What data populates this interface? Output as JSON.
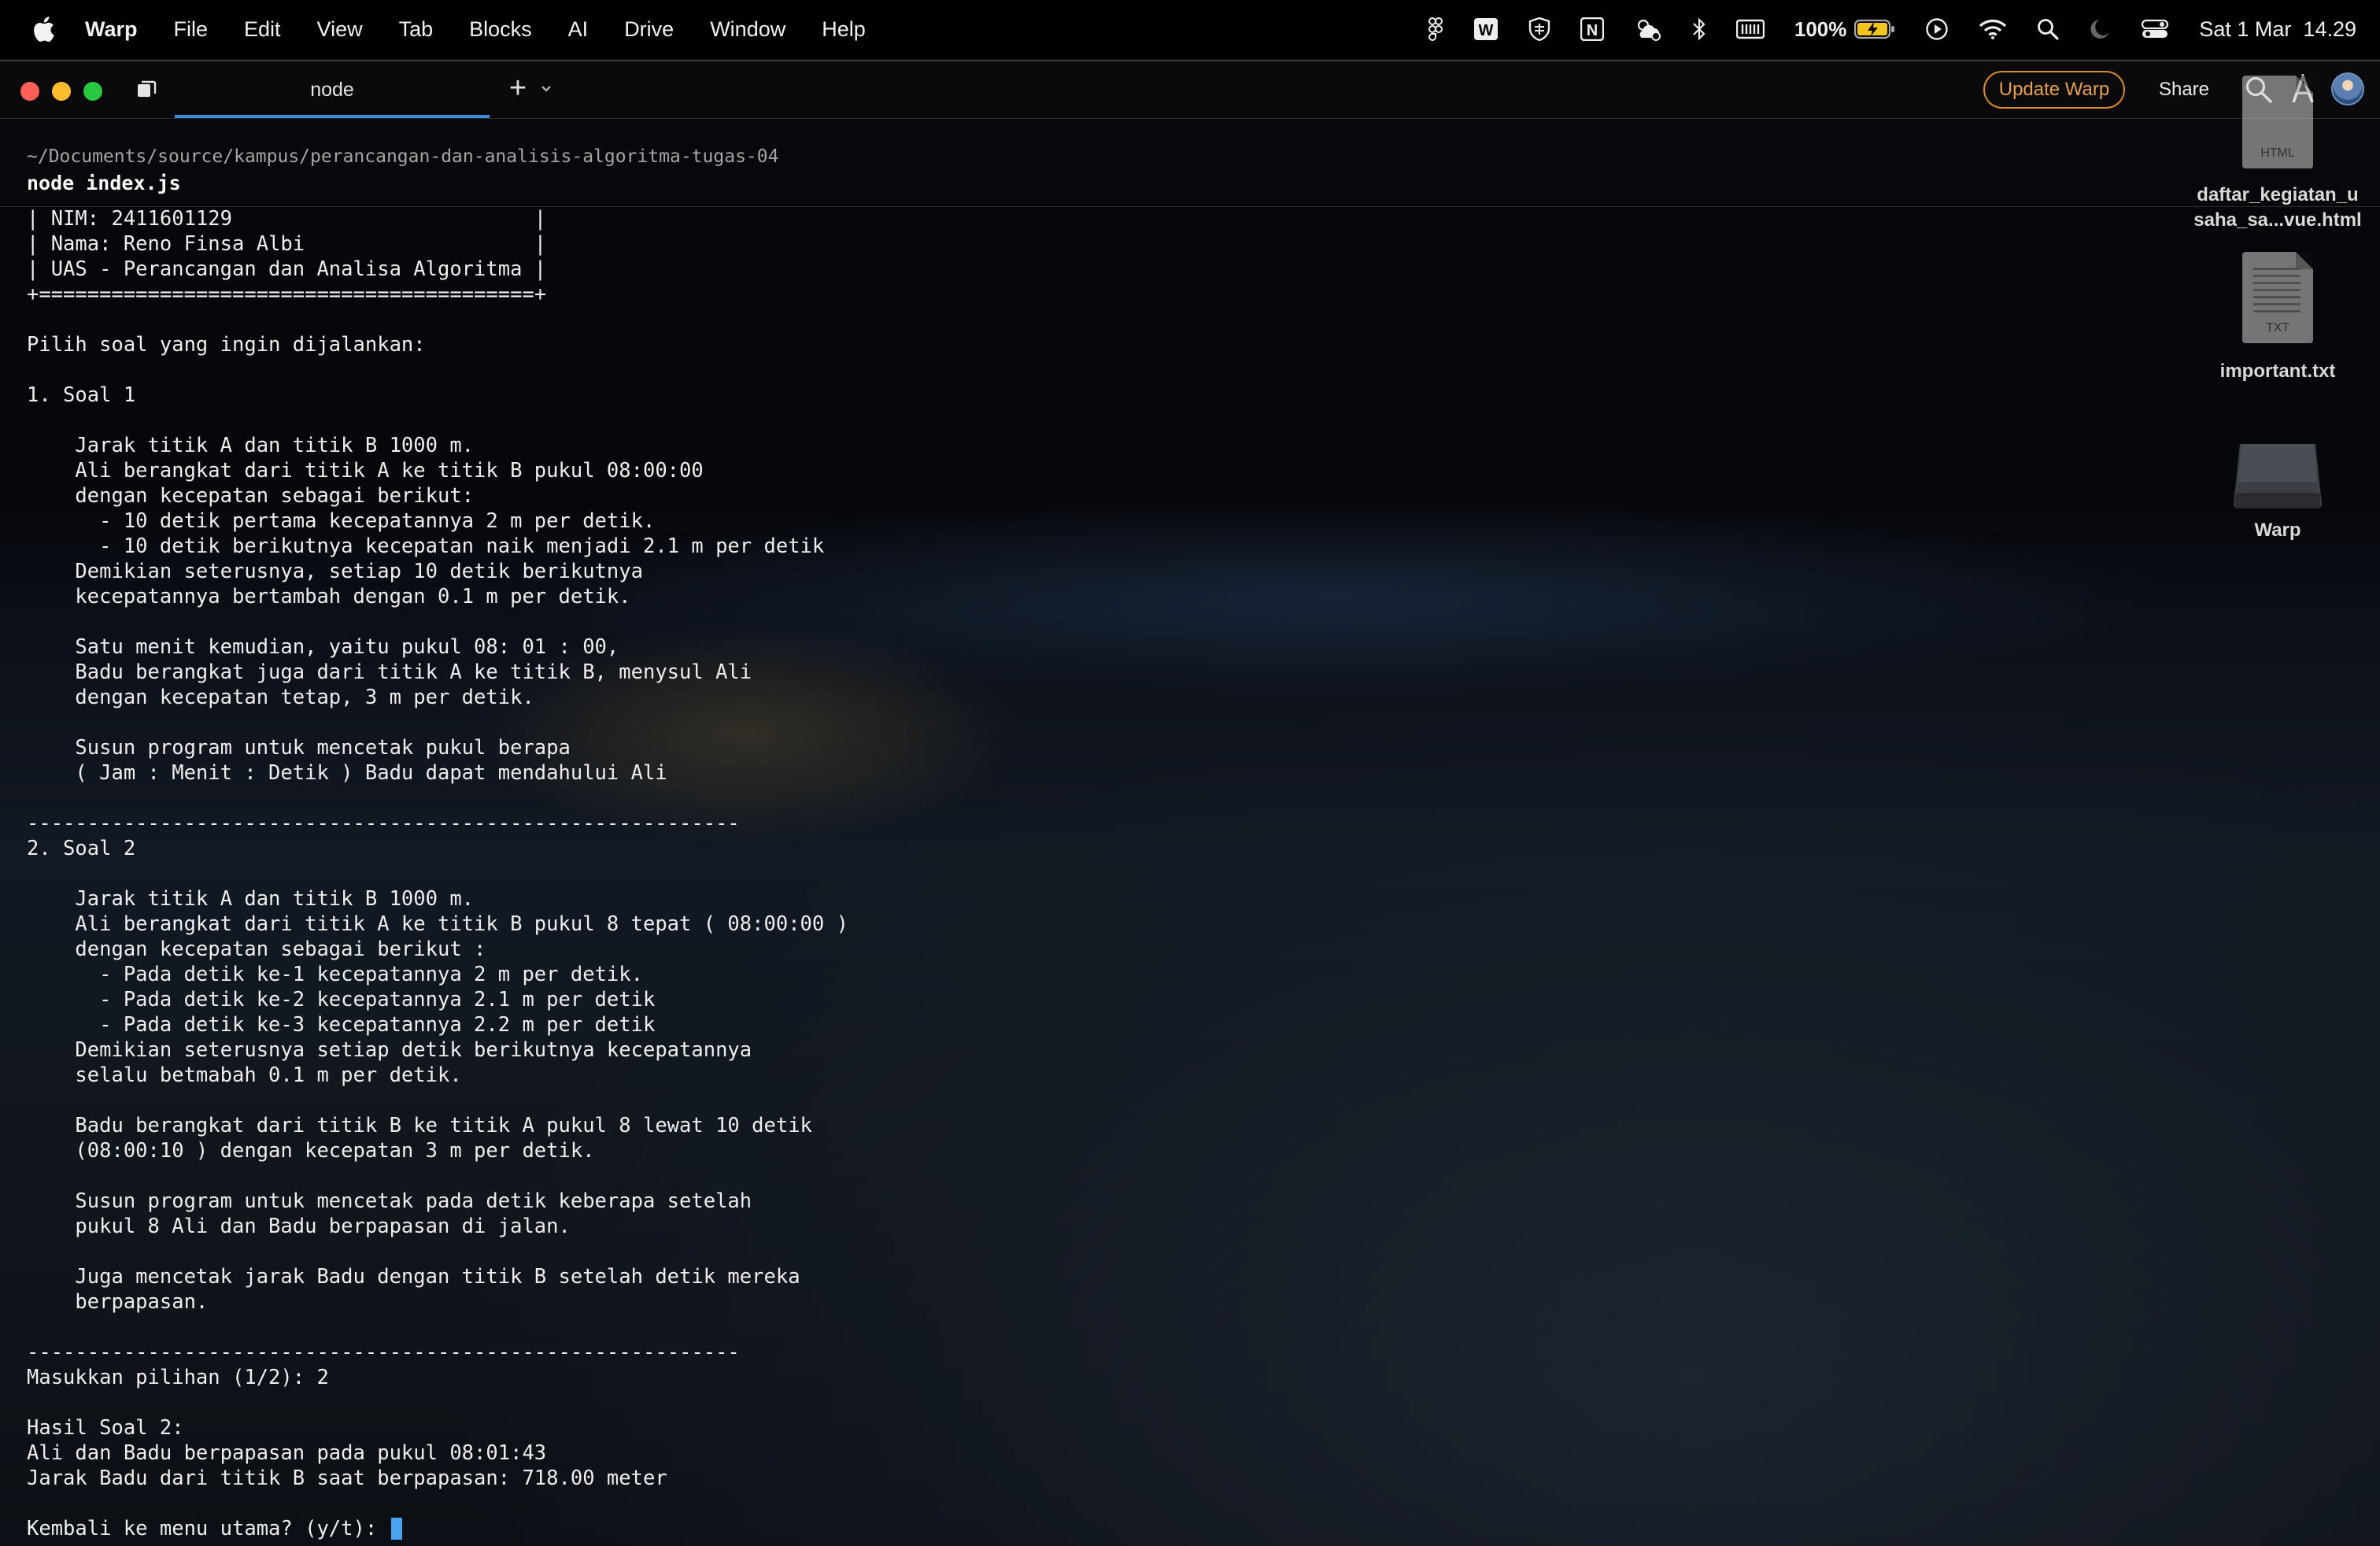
{
  "menubar": {
    "app": "Warp",
    "items": [
      "File",
      "Edit",
      "View",
      "Tab",
      "Blocks",
      "AI",
      "Drive",
      "Window",
      "Help"
    ],
    "battery": "100%",
    "datetime": "Sat 1 Mar  14.29"
  },
  "window": {
    "tab_title": "node",
    "update_button": "Update Warp",
    "share_button": "Share"
  },
  "block": {
    "cwd": "~/Documents/source/kampus/perancangan-dan-analisis-algoritma-tugas-04",
    "command": "node index.js"
  },
  "output_lines": [
    "| NIM: 2411601129                         |",
    "| Nama: Reno Finsa Albi                   |",
    "| UAS - Perancangan dan Analisa Algoritma |",
    "+=========================================+",
    "",
    "Pilih soal yang ingin dijalankan:",
    "",
    "1. Soal 1",
    "",
    "    Jarak titik A dan titik B 1000 m.",
    "    Ali berangkat dari titik A ke titik B pukul 08:00:00",
    "    dengan kecepatan sebagai berikut:",
    "      - 10 detik pertama kecepatannya 2 m per detik.",
    "      - 10 detik berikutnya kecepatan naik menjadi 2.1 m per detik",
    "    Demikian seterusnya, setiap 10 detik berikutnya",
    "    kecepatannya bertambah dengan 0.1 m per detik.",
    "",
    "    Satu menit kemudian, yaitu pukul 08: 01 : 00,",
    "    Badu berangkat juga dari titik A ke titik B, menysul Ali",
    "    dengan kecepatan tetap, 3 m per detik.",
    "",
    "    Susun program untuk mencetak pukul berapa",
    "    ( Jam : Menit : Detik ) Badu dapat mendahului Ali",
    "",
    "-----------------------------------------------------------",
    "2. Soal 2",
    "",
    "    Jarak titik A dan titik B 1000 m.",
    "    Ali berangkat dari titik A ke titik B pukul 8 tepat ( 08:00:00 )",
    "    dengan kecepatan sebagai berikut :",
    "      - Pada detik ke-1 kecepatannya 2 m per detik.",
    "      - Pada detik ke-2 kecepatannya 2.1 m per detik",
    "      - Pada detik ke-3 kecepatannya 2.2 m per detik",
    "    Demikian seterusnya setiap detik berikutnya kecepatannya",
    "    selalu betmabah 0.1 m per detik.",
    "",
    "    Badu berangkat dari titik B ke titik A pukul 8 lewat 10 detik",
    "    (08:00:10 ) dengan kecepatan 3 m per detik.",
    "",
    "    Susun program untuk mencetak pada detik keberapa setelah",
    "    pukul 8 Ali dan Badu berpapasan di jalan.",
    "",
    "    Juga mencetak jarak Badu dengan titik B setelah detik mereka",
    "    berpapasan.",
    "",
    "-----------------------------------------------------------",
    "Masukkan pilihan (1/2): 2",
    "",
    "Hasil Soal 2:",
    "Ali dan Badu berpapasan pada pukul 08:01:43",
    "Jarak Badu dari titik B saat berpapasan: 718.00 meter",
    ""
  ],
  "prompt": "Kembali ke menu utama? (y/t): ",
  "desktop": {
    "html_file": {
      "ext": "HTML",
      "label_line1": "daftar_kegiatan_u",
      "label_line2": "saha_sa...vue.html"
    },
    "txt_file": {
      "ext": "TXT",
      "label": "important.txt"
    },
    "disk": {
      "label": "Warp"
    }
  }
}
